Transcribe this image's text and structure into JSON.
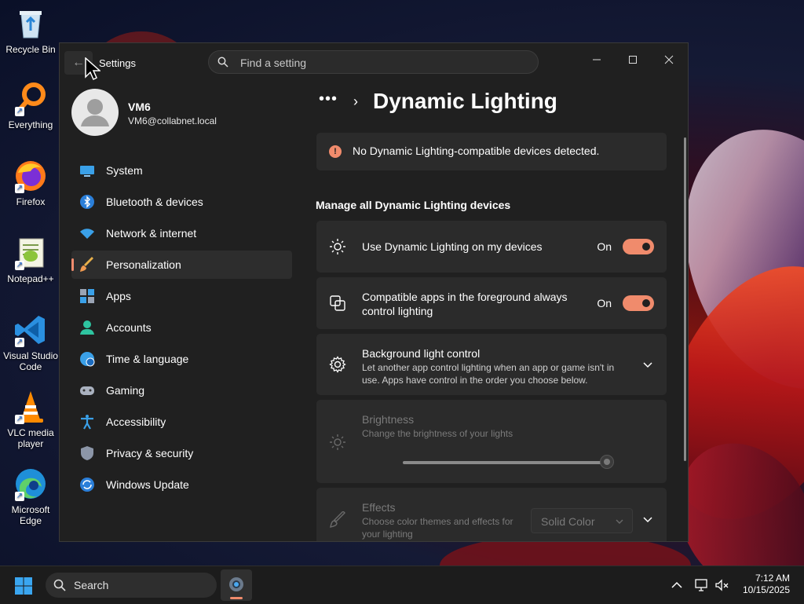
{
  "desktop": {
    "icons": [
      {
        "label": "Recycle Bin"
      },
      {
        "label": "Everything"
      },
      {
        "label": "Firefox"
      },
      {
        "label": "Notepad++"
      },
      {
        "label": "Visual Studio Code"
      },
      {
        "label": "VLC media player"
      },
      {
        "label": "Microsoft Edge"
      }
    ]
  },
  "window": {
    "title": "Settings",
    "search_placeholder": "Find a setting",
    "back_icon": "back-arrow-icon",
    "controls": [
      "minimize",
      "maximize",
      "close"
    ]
  },
  "user": {
    "name": "VM6",
    "email": "VM6@collabnet.local"
  },
  "sidebar": {
    "items": [
      {
        "label": "System",
        "icon": "system-icon"
      },
      {
        "label": "Bluetooth & devices",
        "icon": "bluetooth-icon"
      },
      {
        "label": "Network & internet",
        "icon": "wifi-icon"
      },
      {
        "label": "Personalization",
        "icon": "brush-icon",
        "active": true
      },
      {
        "label": "Apps",
        "icon": "apps-icon"
      },
      {
        "label": "Accounts",
        "icon": "accounts-icon"
      },
      {
        "label": "Time & language",
        "icon": "globe-clock-icon"
      },
      {
        "label": "Gaming",
        "icon": "gamepad-icon"
      },
      {
        "label": "Accessibility",
        "icon": "accessibility-icon"
      },
      {
        "label": "Privacy & security",
        "icon": "shield-icon"
      },
      {
        "label": "Windows Update",
        "icon": "update-icon"
      }
    ]
  },
  "main": {
    "breadcrumb_more": "•••",
    "title": "Dynamic Lighting",
    "info": "No Dynamic Lighting-compatible devices detected.",
    "section": "Manage all Dynamic Lighting devices",
    "settings": [
      {
        "title": "Use Dynamic Lighting on my devices",
        "state": "On"
      },
      {
        "title": "Compatible apps in the foreground always control lighting",
        "state": "On"
      },
      {
        "title": "Background light control",
        "subtitle": "Let another app control lighting when an app or game isn't in use. Apps have control in the order you choose below."
      },
      {
        "title": "Brightness",
        "subtitle": "Change the brightness of your lights",
        "value": 100
      },
      {
        "title": "Effects",
        "subtitle": "Choose color themes and effects for your lighting",
        "dropdown": "Solid Color"
      }
    ]
  },
  "taskbar": {
    "search_label": "Search",
    "time": "7:12 AM",
    "date": "10/15/2025"
  },
  "colors": {
    "accent": "#f08b6c",
    "window_bg": "#202020",
    "card_bg": "#2b2b2b"
  }
}
